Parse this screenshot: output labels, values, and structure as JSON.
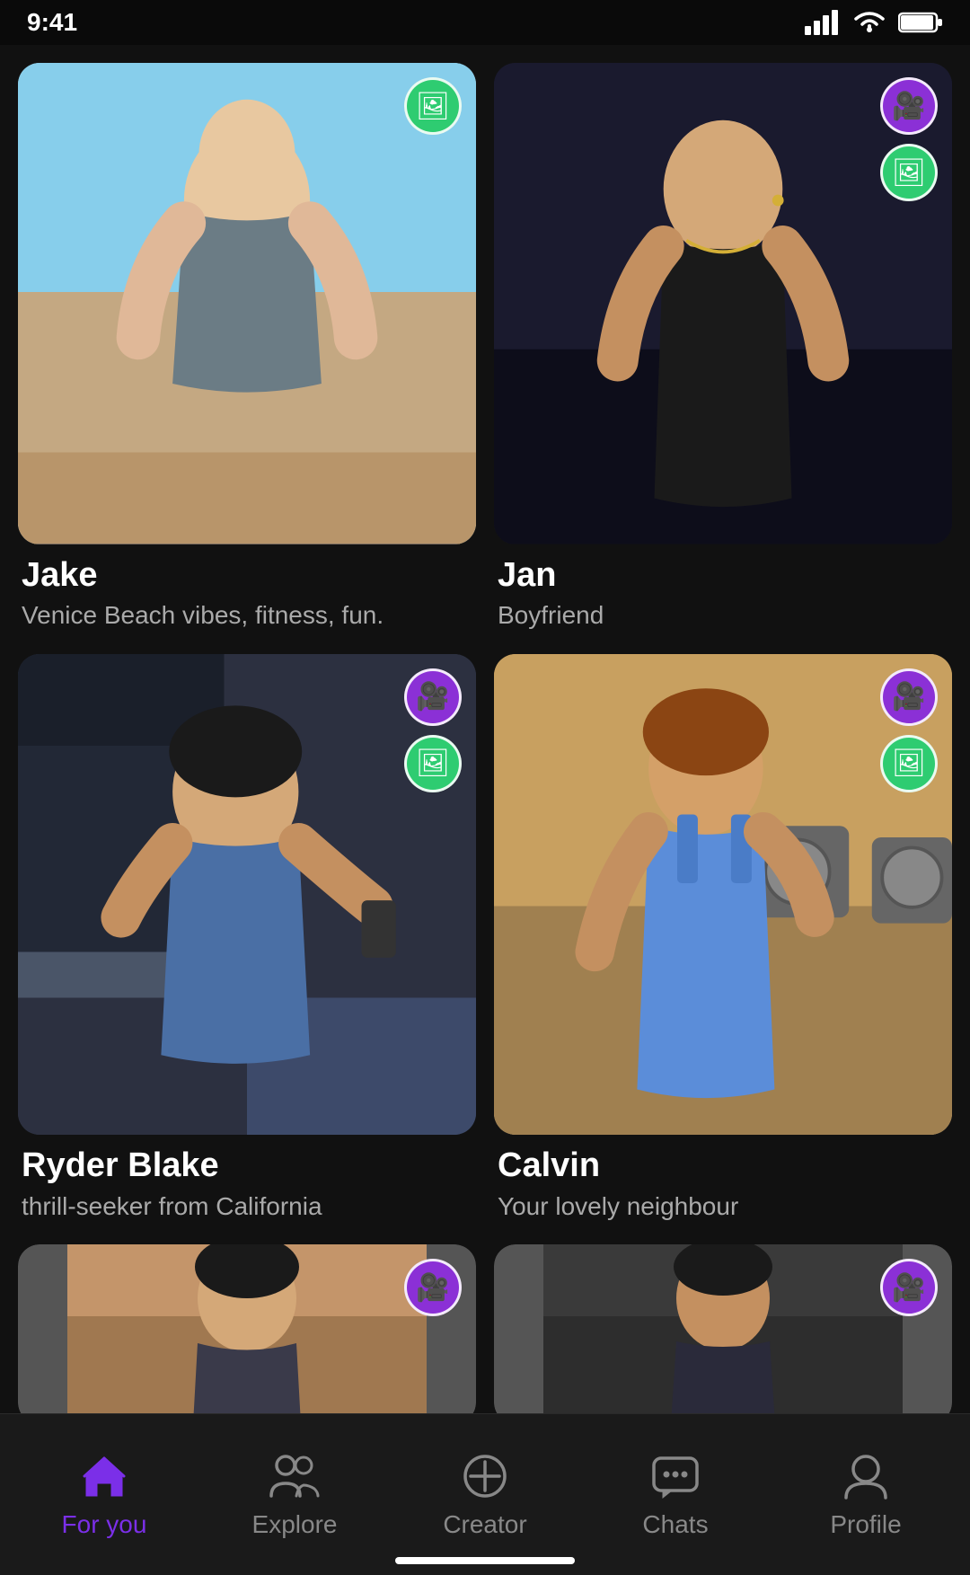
{
  "statusBar": {
    "time": "9:41"
  },
  "cards": [
    {
      "id": "jake",
      "name": "Jake",
      "description": "Venice Beach vibes, fitness, fun.",
      "hasBadges": [
        "gallery"
      ],
      "figureClass": "jake-figure"
    },
    {
      "id": "jan",
      "name": "Jan",
      "description": "Boyfriend",
      "hasBadges": [
        "video",
        "gallery"
      ],
      "figureClass": "jan-figure"
    },
    {
      "id": "ryder",
      "name": "Ryder Blake",
      "description": "thrill-seeker from California",
      "hasBadges": [
        "video",
        "gallery"
      ],
      "figureClass": "ryder-figure"
    },
    {
      "id": "calvin",
      "name": "Calvin",
      "description": "Your lovely neighbour",
      "hasBadges": [
        "video",
        "gallery"
      ],
      "figureClass": "calvin-figure"
    }
  ],
  "partialCards": [
    {
      "id": "partial1",
      "hasBadges": [
        "video"
      ],
      "figureClass": "partial1-figure"
    },
    {
      "id": "partial2",
      "hasBadges": [
        "video"
      ],
      "figureClass": "partial2-figure"
    }
  ],
  "bottomNav": {
    "items": [
      {
        "id": "for-you",
        "label": "For you",
        "active": true
      },
      {
        "id": "explore",
        "label": "Explore",
        "active": false
      },
      {
        "id": "creator",
        "label": "Creator",
        "active": false
      },
      {
        "id": "chats",
        "label": "Chats",
        "active": false
      },
      {
        "id": "profile",
        "label": "Profile",
        "active": false
      }
    ]
  }
}
